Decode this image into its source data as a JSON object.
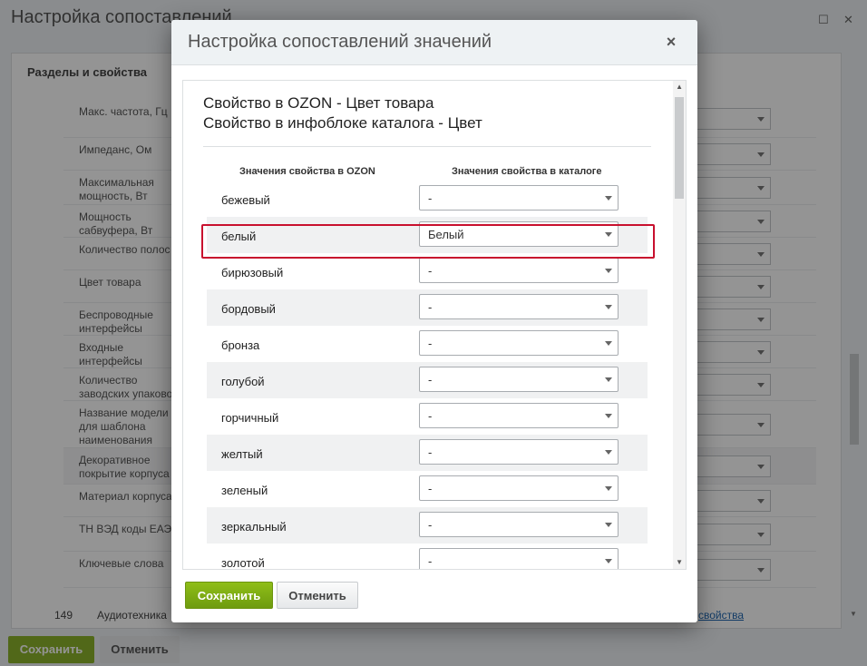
{
  "background": {
    "title": "Настройка сопоставлений",
    "section_header": "Разделы и свойства",
    "rows": [
      {
        "label": "Макс. частота, Гц",
        "alt": false
      },
      {
        "label": "Импеданс, Ом",
        "alt": false
      },
      {
        "label": "Максимальная мощность, Вт",
        "alt": false
      },
      {
        "label": "Мощность сабвуфера, Вт",
        "alt": false
      },
      {
        "label": "Количество полос",
        "alt": false
      },
      {
        "label": "Цвет товара",
        "alt": false
      },
      {
        "label": "Беспроводные интерфейсы",
        "alt": false
      },
      {
        "label": "Входные интерфейсы",
        "alt": false
      },
      {
        "label": "Количество заводских упаковок",
        "alt": false
      },
      {
        "label": "Название модели для шаблона наименования",
        "alt": false
      },
      {
        "label": "Декоративное покрытие корпуса",
        "alt": true
      },
      {
        "label": "Материал корпуса",
        "alt": false
      },
      {
        "label": "ТН ВЭД коды ЕАЭС",
        "alt": false
      },
      {
        "label": "Ключевые слова",
        "alt": false
      }
    ],
    "footer_row": {
      "num": "149",
      "name": "Аудиотехника",
      "link": "свойства"
    },
    "save_label": "Сохранить",
    "cancel_label": "Отменить"
  },
  "dialog": {
    "title": "Настройка сопоставлений значений",
    "prop_line1": "Свойство в OZON - Цвет товара",
    "prop_line2": "Свойство в инфоблоке каталога - Цвет",
    "col_ozon": "Значения свойства в OZON",
    "col_catalog": "Значения свойства в каталоге",
    "rows": [
      {
        "label": "бежевый",
        "value": "-"
      },
      {
        "label": "белый",
        "value": "Белый"
      },
      {
        "label": "бирюзовый",
        "value": "-"
      },
      {
        "label": "бордовый",
        "value": "-"
      },
      {
        "label": "бронза",
        "value": "-"
      },
      {
        "label": "голубой",
        "value": "-"
      },
      {
        "label": "горчичный",
        "value": "-"
      },
      {
        "label": "желтый",
        "value": "-"
      },
      {
        "label": "зеленый",
        "value": "-"
      },
      {
        "label": "зеркальный",
        "value": "-"
      },
      {
        "label": "золотой",
        "value": "-"
      }
    ],
    "save_label": "Сохранить",
    "cancel_label": "Отменить"
  },
  "colors": {
    "accent_green": "#7aa81a",
    "highlight_red": "#c8102e"
  }
}
